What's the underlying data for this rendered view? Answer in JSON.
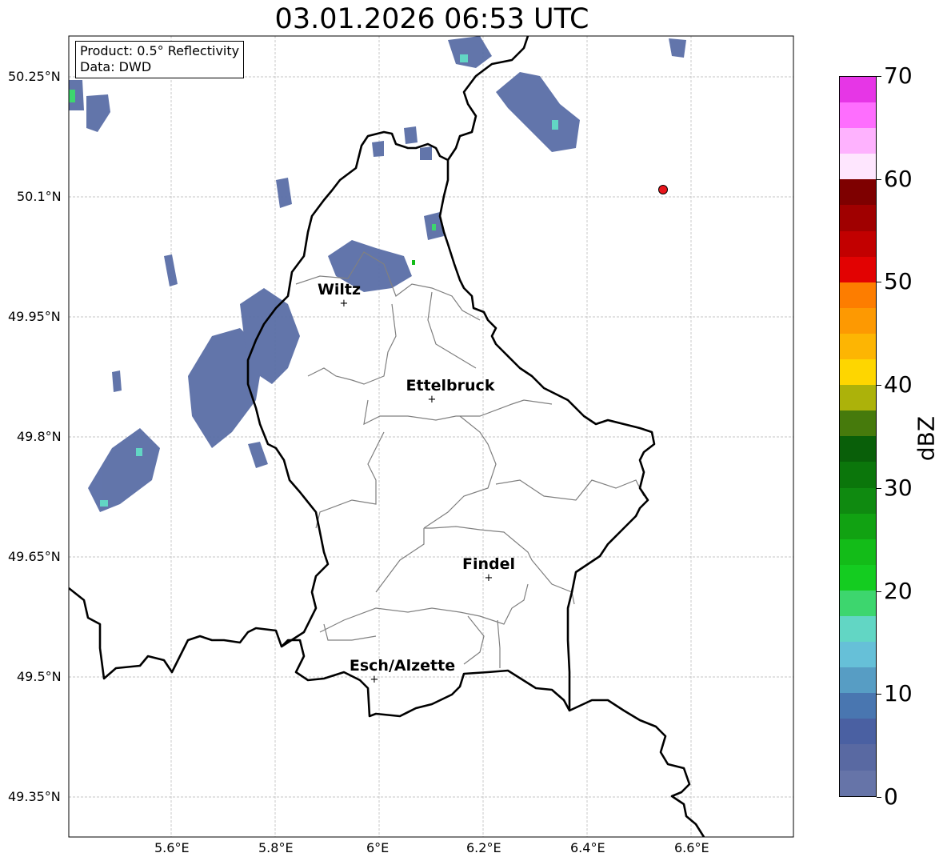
{
  "title": "03.01.2026 06:53 UTC",
  "info": {
    "product": "Product: 0.5° Reflectivity",
    "data": "Data: DWD"
  },
  "map": {
    "lon_ticks": [
      "5.6°E",
      "5.8°E",
      "6°E",
      "6.2°E",
      "6.4°E",
      "6.6°E"
    ],
    "lat_ticks": [
      "50.25°N",
      "50.1°N",
      "49.95°N",
      "49.8°N",
      "49.65°N",
      "49.5°N",
      "49.35°N"
    ],
    "cities": [
      {
        "name": "Wiltz",
        "lon": 5.93,
        "lat": 49.967
      },
      {
        "name": "Ettelbruck",
        "lon": 6.1,
        "lat": 49.848
      },
      {
        "name": "Findel",
        "lon": 6.21,
        "lat": 49.627
      },
      {
        "name": "Esch/Alzette",
        "lon": 5.99,
        "lat": 49.5
      }
    ],
    "radar_site": {
      "lon": 6.548,
      "lat": 50.11,
      "color": "#e8151b"
    }
  },
  "colorbar": {
    "label": "dBZ",
    "ticks": [
      "0",
      "10",
      "20",
      "30",
      "40",
      "50",
      "60",
      "70"
    ],
    "colors": [
      "#6674a8",
      "#5969a2",
      "#4a60a2",
      "#4976b0",
      "#579dc4",
      "#66c0d8",
      "#62d6c4",
      "#3dd66e",
      "#14cc20",
      "#13bc18",
      "#11a212",
      "#0f8a10",
      "#0b760b",
      "#095f09",
      "#467a0c",
      "#acb20a",
      "#fed600",
      "#fdb503",
      "#fd9902",
      "#fd7d00",
      "#e20202",
      "#c20000",
      "#a00000",
      "#7e0000",
      "#fee6fe",
      "#feb2fe",
      "#fe6efe",
      "#e636e6"
    ]
  }
}
